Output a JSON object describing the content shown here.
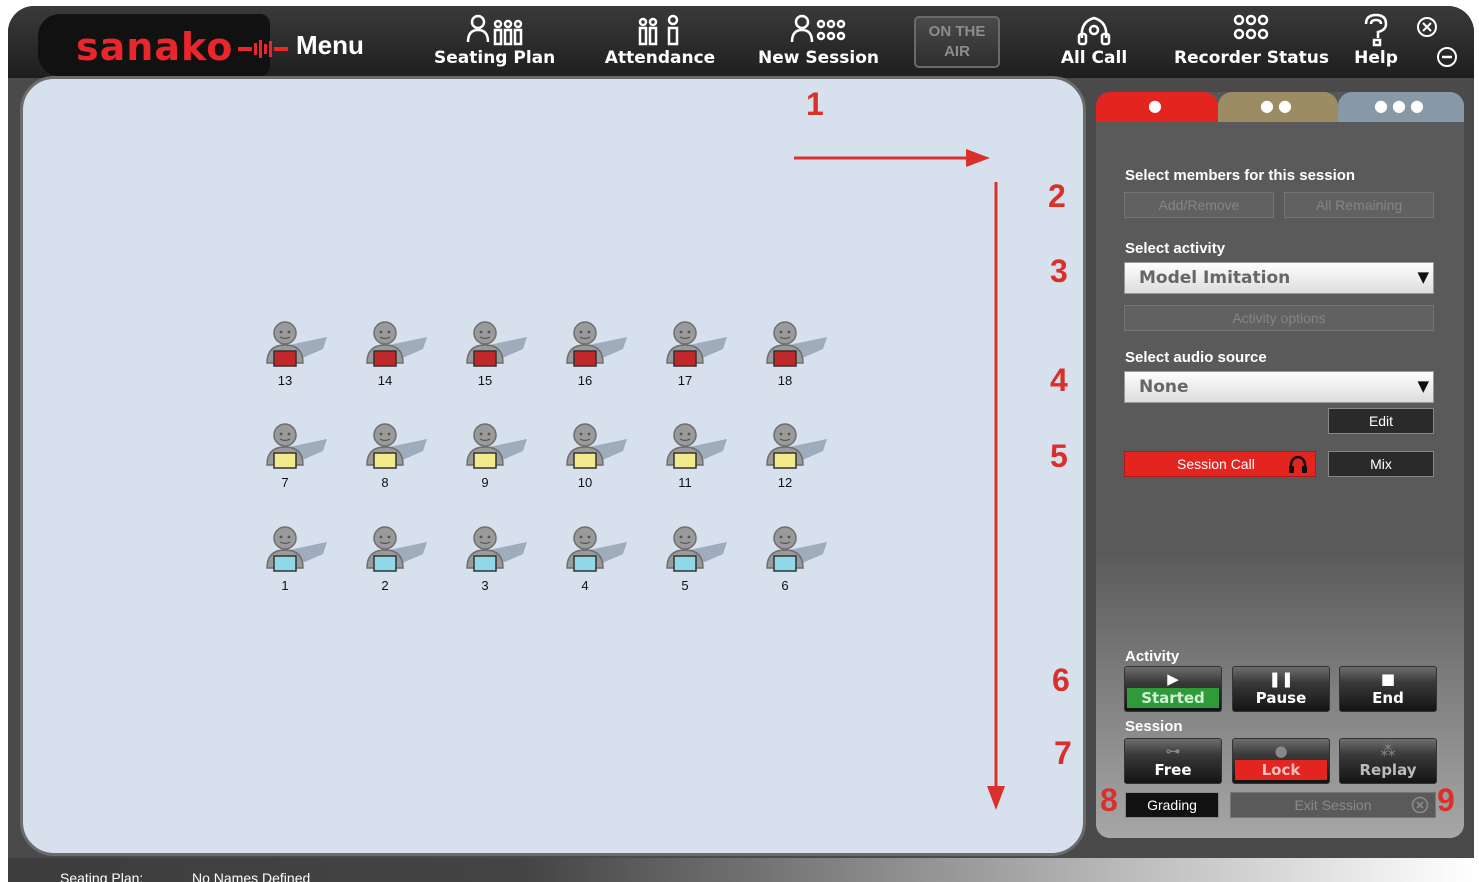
{
  "app": {
    "logo_text": "sanako",
    "menu_label": "Menu"
  },
  "toolbar": {
    "seating_plan": "Seating Plan",
    "attendance": "Attendance",
    "new_session": "New Session",
    "on_air": "ON THE AIR",
    "all_call": "All Call",
    "recorder_status": "Recorder Status",
    "help": "Help"
  },
  "students": [
    {
      "num": "13",
      "color": "#c0282a"
    },
    {
      "num": "14",
      "color": "#c0282a"
    },
    {
      "num": "15",
      "color": "#c0282a"
    },
    {
      "num": "16",
      "color": "#c0282a"
    },
    {
      "num": "17",
      "color": "#c0282a"
    },
    {
      "num": "18",
      "color": "#c0282a"
    },
    {
      "num": "7",
      "color": "#f3e98d"
    },
    {
      "num": "8",
      "color": "#f3e98d"
    },
    {
      "num": "9",
      "color": "#f3e98d"
    },
    {
      "num": "10",
      "color": "#f3e98d"
    },
    {
      "num": "11",
      "color": "#f3e98d"
    },
    {
      "num": "12",
      "color": "#f3e98d"
    },
    {
      "num": "1",
      "color": "#8fd8ea"
    },
    {
      "num": "2",
      "color": "#8fd8ea"
    },
    {
      "num": "3",
      "color": "#8fd8ea"
    },
    {
      "num": "4",
      "color": "#8fd8ea"
    },
    {
      "num": "5",
      "color": "#8fd8ea"
    },
    {
      "num": "6",
      "color": "#8fd8ea"
    }
  ],
  "panel": {
    "tabs": [
      {
        "dots": "●"
      },
      {
        "dots": "●●"
      },
      {
        "dots": "●●●"
      }
    ],
    "members_label": "Select members for this session",
    "add_remove": "Add/Remove",
    "all_remaining": "All Remaining",
    "activity_label": "Select activity",
    "activity_value": "Model Imitation",
    "activity_options": "Activity options",
    "audio_label": "Select audio source",
    "audio_value": "None",
    "edit": "Edit",
    "session_call": "Session Call",
    "mix": "Mix",
    "activity_section": "Activity",
    "started": "Started",
    "pause": "Pause",
    "end": "End",
    "session_section": "Session",
    "free": "Free",
    "lock": "Lock",
    "replay": "Replay",
    "grading": "Grading",
    "exit_session": "Exit Session"
  },
  "annotations": [
    "1",
    "2",
    "3",
    "4",
    "5",
    "6",
    "7",
    "8",
    "9"
  ],
  "colors": {
    "accent_red": "#e3241f",
    "started_green": "#2f9a3a",
    "canvas_bg": "#d7e1ed"
  },
  "status": {
    "label": "Seating Plan:",
    "value": "No Names Defined"
  }
}
